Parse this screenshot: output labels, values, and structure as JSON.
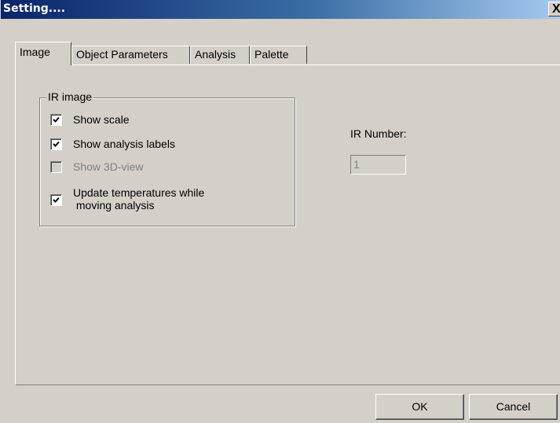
{
  "window": {
    "title": "Setting....",
    "close_glyph": "X",
    "close_icon": "close-icon"
  },
  "tabs": [
    {
      "label": "Image",
      "active": true
    },
    {
      "label": "Object Parameters",
      "active": false
    },
    {
      "label": "Analysis",
      "active": false
    },
    {
      "label": "Palette",
      "active": false
    }
  ],
  "ir_image_group": {
    "legend": "IR image",
    "options": [
      {
        "label": "Show scale",
        "checked": true,
        "enabled": true
      },
      {
        "label": "Show analysis labels",
        "checked": true,
        "enabled": true
      },
      {
        "label": "Show 3D-view",
        "checked": false,
        "enabled": false
      },
      {
        "label_line1": "Update temperatures while",
        "label_line2": " moving analysis",
        "checked": true,
        "enabled": true
      }
    ]
  },
  "ir_number": {
    "label": "IR Number:",
    "value": "1",
    "enabled": false
  },
  "buttons": {
    "ok_label": "OK",
    "cancel_label": "Cancel"
  }
}
